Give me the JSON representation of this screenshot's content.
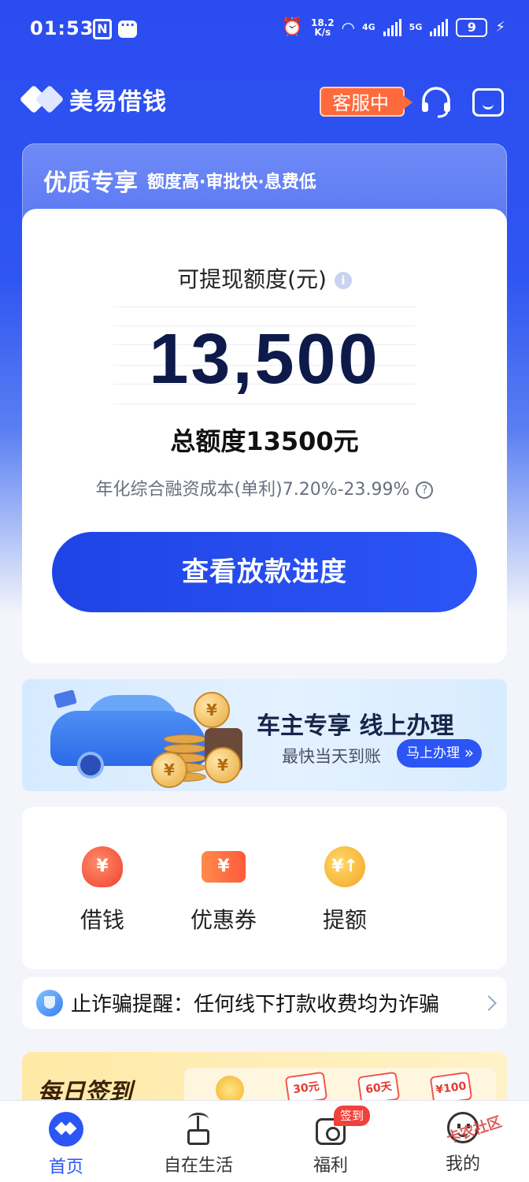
{
  "status_bar": {
    "time": "01:53",
    "net_speed_value": "18.2",
    "net_speed_unit": "K/s",
    "network_4g": "4G",
    "network_5g": "5G",
    "battery": "9"
  },
  "header": {
    "brand_name": "美易借钱",
    "service_badge": "客服中"
  },
  "promo_strip": {
    "title": "优质专享",
    "subtitle": "额度高·审批快·息费低"
  },
  "limit_card": {
    "label": "可提现额度(元)",
    "amount": "13,500",
    "total": "总额度13500元",
    "rate": "年化综合融资成本(单利)7.20%-23.99%",
    "cta": "查看放款进度"
  },
  "car_banner": {
    "title": "车主专享 线上办理",
    "subtitle": "最快当天到账",
    "button": "马上办理"
  },
  "quick_entries": [
    {
      "label": "借钱",
      "icon": "money-bag-icon"
    },
    {
      "label": "优惠券",
      "icon": "coupon-icon"
    },
    {
      "label": "提额",
      "icon": "raise-limit-icon"
    }
  ],
  "notice": {
    "text": "止诈骗提醒：任何线下打款收费均为诈骗"
  },
  "signin": {
    "title": "每日签到",
    "rewards": [
      "30元",
      "60天",
      "¥100"
    ]
  },
  "bottom_nav": {
    "items": [
      {
        "label": "首页",
        "icon": "home-icon",
        "active": true
      },
      {
        "label": "自在生活",
        "icon": "plant-icon",
        "active": false
      },
      {
        "label": "福利",
        "icon": "gift-icon",
        "active": false
      },
      {
        "label": "我的",
        "icon": "profile-icon",
        "active": false
      }
    ],
    "signin_badge": "签到"
  },
  "watermark": "卡农社区",
  "colors": {
    "brand_blue": "#2c55f5",
    "service_orange": "#ff6a3c",
    "badge_red": "#f0413a"
  }
}
